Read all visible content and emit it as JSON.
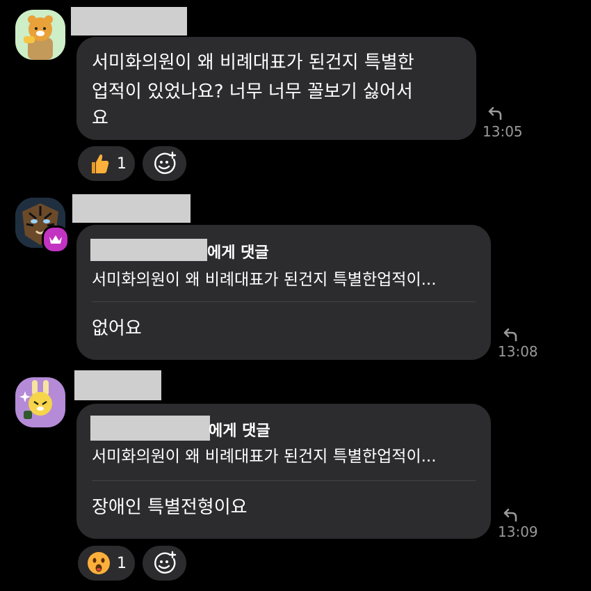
{
  "messages": [
    {
      "text_lines": [
        "서미화의원이 왜 비례대표가 된건지 특별한",
        "업적이 있었나요?  너무 너무 꼴보기 싫어서",
        "요"
      ],
      "time": "13:05",
      "reaction": {
        "icon": "thumbs-up",
        "count": "1"
      }
    },
    {
      "quote_suffix": "에게 댓글",
      "quote_text": "서미화의원이 왜 비례대표가 된건지 특별한업적이...",
      "text": "없어요",
      "time": "13:08"
    },
    {
      "quote_suffix": "에게 댓글",
      "quote_text": "서미화의원이 왜 비례대표가 된건지 특별한업적이...",
      "text": "장애인 특별전형이요",
      "time": "13:09",
      "reaction": {
        "icon": "surprised-face",
        "count": "1"
      }
    }
  ],
  "colors": {
    "background": "#000000",
    "bubble": "#2c2c2e",
    "time": "#9a9a9a",
    "crown_badge": "#c233c2",
    "redaction": "#cfcfcf"
  }
}
